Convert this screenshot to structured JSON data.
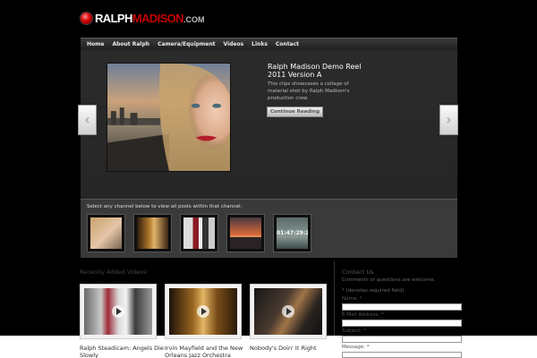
{
  "logo": {
    "part1": "RALPH",
    "part2": "MADISON",
    "part3": ".COM"
  },
  "nav": {
    "items": [
      {
        "label": "Home"
      },
      {
        "label": "About Ralph"
      },
      {
        "label": "Camera/Equipment"
      },
      {
        "label": "Videos"
      },
      {
        "label": "Links"
      },
      {
        "label": "Contact"
      }
    ]
  },
  "featured": {
    "title": "Ralph Madison Demo Reel 2011 Version A",
    "description": "This clips showcases a collage of material shot by Ralph Madison's production crew.",
    "button": "Continue Reading"
  },
  "slider": {
    "prev_icon": "chevron-left-icon",
    "next_icon": "chevron-right-icon"
  },
  "channels": {
    "label": "Select any channel below to view all posts within that channel:",
    "items": [
      {
        "timestamp": ""
      },
      {
        "timestamp": ""
      },
      {
        "timestamp": ""
      },
      {
        "timestamp": ""
      },
      {
        "timestamp": "01:47:29:23"
      }
    ]
  },
  "recent": {
    "heading": "Recently Added Videos:",
    "videos": [
      {
        "title": "Ralph Steadicam: Angels Die Slowly"
      },
      {
        "title": "Irvin Mayfield and the New Orleans Jazz Orchestra"
      },
      {
        "title": "Nobody's Doin' It Right"
      }
    ]
  },
  "contact": {
    "heading": "Contact Us",
    "subheading": "Comments or questions are welcome.",
    "note": "* (denotes required field)",
    "fields": [
      {
        "label": "Name: *"
      },
      {
        "label": "E-Mail Address: *"
      },
      {
        "label": "Subject: *"
      },
      {
        "label": "Message: *"
      }
    ]
  },
  "colors": {
    "accent": "#c40000",
    "background": "#000000",
    "panel": "#2b2b2b"
  }
}
